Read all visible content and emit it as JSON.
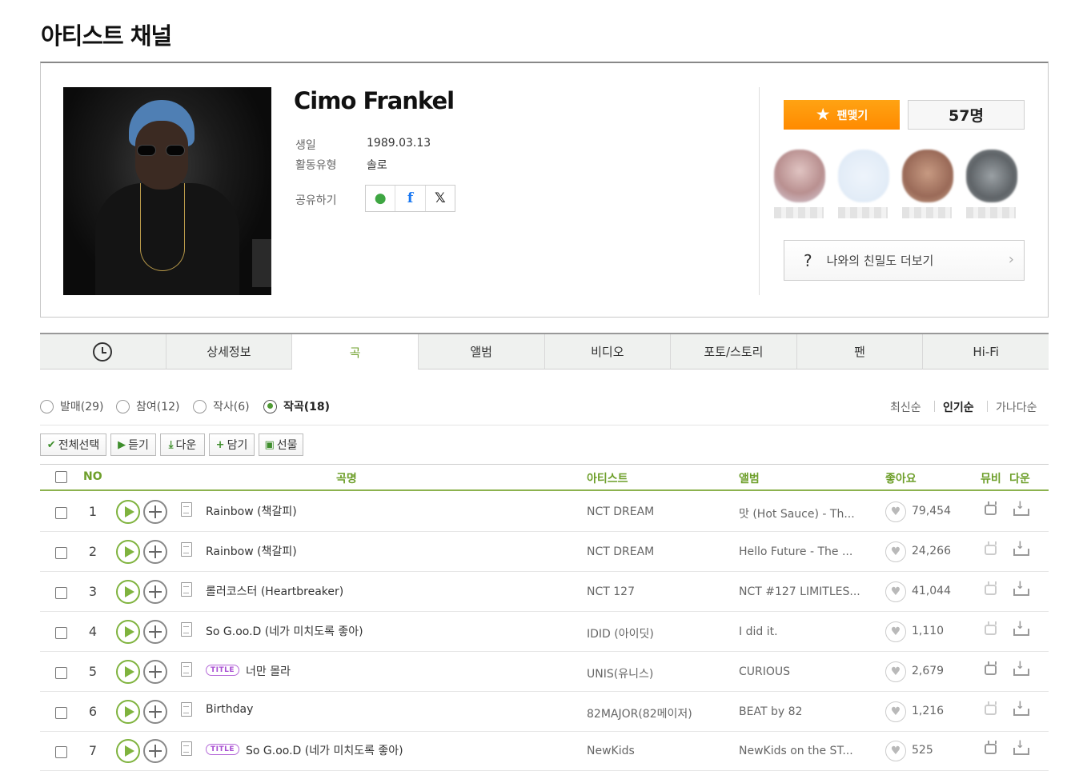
{
  "page": {
    "title": "아티스트 채널"
  },
  "artist": {
    "name": "Cimo Frankel",
    "birth_label": "생일",
    "birth_value": "1989.03.13",
    "type_label": "활동유형",
    "type_value": "솔로",
    "share_label": "공유하기"
  },
  "fan": {
    "button_label": "팬맺기",
    "count": "57명"
  },
  "intimacy": {
    "q": "?",
    "label": "나와의 친밀도 더보기",
    "arrow": "›"
  },
  "tabs": [
    {
      "label": ""
    },
    {
      "label": "상세정보"
    },
    {
      "label": "곡"
    },
    {
      "label": "앨범"
    },
    {
      "label": "비디오"
    },
    {
      "label": "포토/스토리"
    },
    {
      "label": "팬"
    },
    {
      "label": "Hi-Fi"
    }
  ],
  "filters": [
    {
      "label": "발매(29)"
    },
    {
      "label": "참여(12)"
    },
    {
      "label": "작사(6)"
    },
    {
      "label": "작곡(18)"
    }
  ],
  "sort": [
    {
      "label": "최신순"
    },
    {
      "label": "인기순"
    },
    {
      "label": "가나다순"
    }
  ],
  "actions": [
    {
      "icon": "✔",
      "label": "전체선택"
    },
    {
      "icon": "▶",
      "label": "듣기"
    },
    {
      "icon": "⤓",
      "label": "다운"
    },
    {
      "icon": "+",
      "label": "담기"
    },
    {
      "icon": "▣",
      "label": "선물"
    }
  ],
  "columns": {
    "no": "NO",
    "song": "곡명",
    "artist": "아티스트",
    "album": "앨범",
    "likes": "좋아요",
    "mv": "뮤비",
    "down": "다운"
  },
  "title_badge": "TITLE",
  "heart_icon": "♥",
  "rows": [
    {
      "no": "1",
      "song": "Rainbow (책갈피)",
      "artist": "NCT DREAM",
      "album": "맛 (Hot Sauce) - Th...",
      "likes": "79,454"
    },
    {
      "no": "2",
      "song": "Rainbow (책갈피)",
      "artist": "NCT DREAM",
      "album": "Hello Future - The ...",
      "likes": "24,266"
    },
    {
      "no": "3",
      "song": "롤러코스터 (Heartbreaker)",
      "artist": "NCT 127",
      "album": "NCT #127 LIMITLES...",
      "likes": "41,044"
    },
    {
      "no": "4",
      "song": "So G.oo.D (네가 미치도록 좋아)",
      "artist": "IDID (아이딧)",
      "album": "I did it.",
      "likes": "1,110"
    },
    {
      "no": "5",
      "song": "너만 몰라",
      "artist": "UNIS(유니스)",
      "album": "CURIOUS",
      "likes": "2,679"
    },
    {
      "no": "6",
      "song": "Birthday",
      "artist": "82MAJOR(82메이저)",
      "album": "BEAT by 82",
      "likes": "1,216"
    },
    {
      "no": "7",
      "song": "So G.oo.D (네가 미치도록 좋아)",
      "artist": "NewKids",
      "album": "NewKids on the ST...",
      "likes": "525"
    }
  ],
  "colors": {
    "accent": "#6e9f2b",
    "fan_button": "#ff9400",
    "title_badge": "#a94fd3"
  }
}
